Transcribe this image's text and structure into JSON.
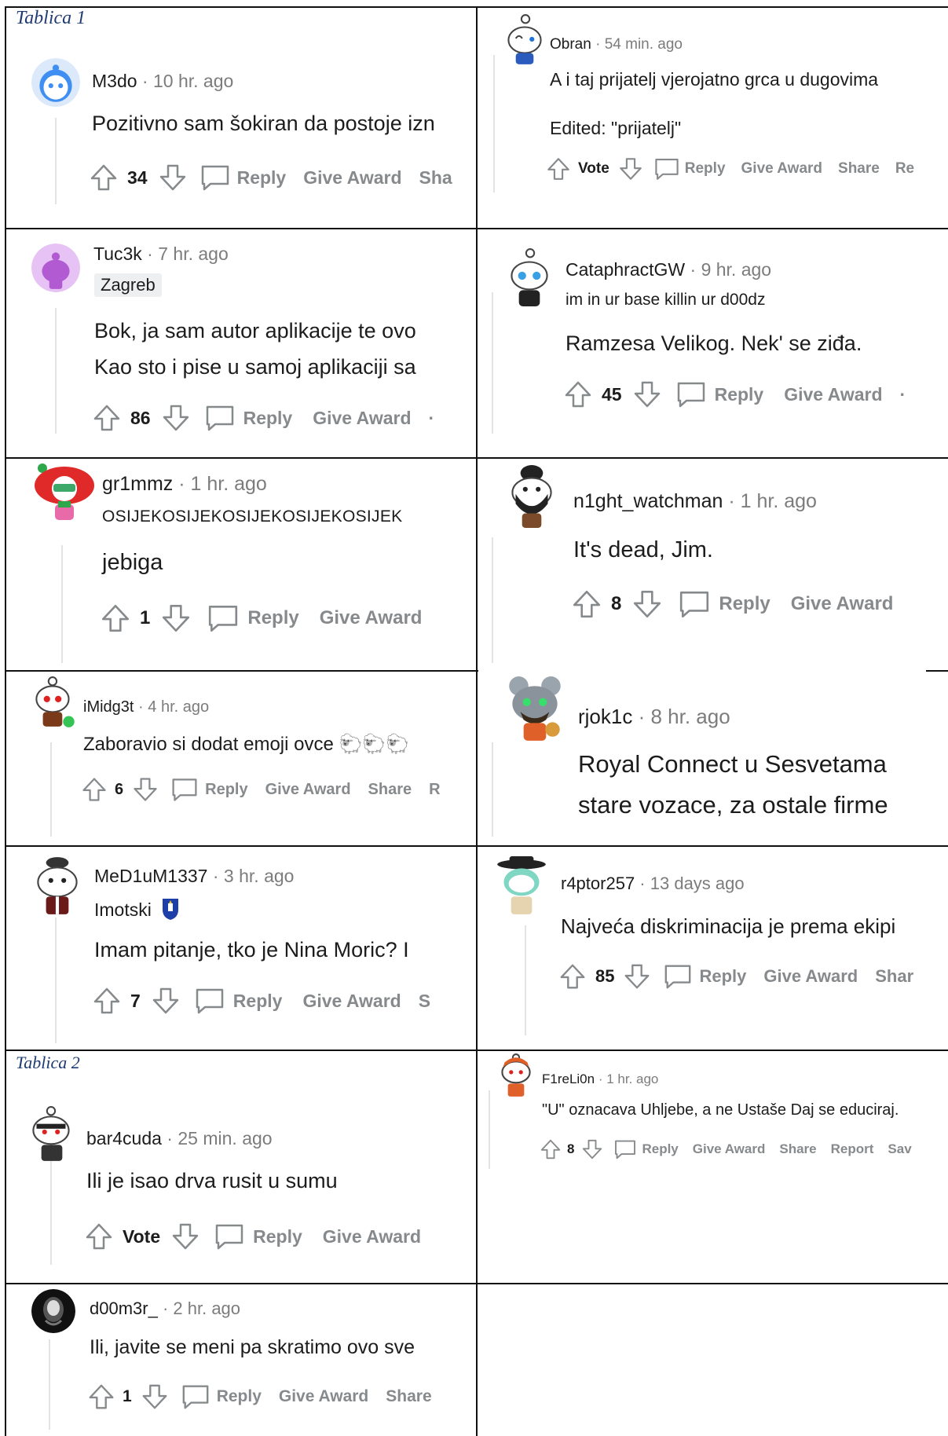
{
  "tables": [
    {
      "label": "Tablica 1"
    },
    {
      "label": "Tablica 2"
    }
  ],
  "comments": [
    {
      "id": "m3do",
      "user": "M3do",
      "time": "10 hr. ago",
      "lines": [
        "Pozitivno sam šokiran da postoje izn"
      ],
      "score": "34",
      "actions": [
        "Reply",
        "Give Award",
        "Sha"
      ]
    },
    {
      "id": "obran",
      "user": "Obran",
      "time": "54 min. ago",
      "lines": [
        "A i taj prijatelj vjerojatno grca u dugovima",
        "Edited: \"prijatelj\""
      ],
      "score": "Vote",
      "actions": [
        "Reply",
        "Give Award",
        "Share",
        "Re"
      ]
    },
    {
      "id": "tuc3k",
      "user": "Tuc3k",
      "time": "7 hr. ago",
      "flair": "Zagreb",
      "lines": [
        "Bok, ja sam autor aplikacije te ovo",
        "Kao sto i pise u samoj aplikaciji sa"
      ],
      "score": "86",
      "actions": [
        "Reply",
        "Give Award",
        "·"
      ]
    },
    {
      "id": "cataphract",
      "user": "CataphractGW",
      "time": "9 hr. ago",
      "flair": "im in ur base killin ur d00dz",
      "lines": [
        "Ramzesa Velikog. Nek' se ziđa."
      ],
      "score": "45",
      "actions": [
        "Reply",
        "Give Award",
        "·"
      ]
    },
    {
      "id": "gr1mmz",
      "user": "gr1mmz",
      "time": "1 hr. ago",
      "flair": "OSIJEKOSIJEKOSIJEKOSIJEKOSIJEK",
      "lines": [
        "jebiga"
      ],
      "score": "1",
      "actions": [
        "Reply",
        "Give Award"
      ]
    },
    {
      "id": "n1ght",
      "user": "n1ght_watchman",
      "time": "1 hr. ago",
      "lines": [
        "It's dead, Jim."
      ],
      "score": "8",
      "actions": [
        "Reply",
        "Give Award"
      ]
    },
    {
      "id": "imidg3t",
      "user": "iMidg3t",
      "time": "4 hr. ago",
      "lines": [
        "Zaboravio si dodat emoji ovce 🐑🐑🐑"
      ],
      "score": "6",
      "actions": [
        "Reply",
        "Give Award",
        "Share",
        "R"
      ]
    },
    {
      "id": "rjok1c",
      "user": "rjok1c",
      "time": "8 hr. ago",
      "lines": [
        "Royal Connect u Sesvetama",
        "stare vozace, za ostale firme"
      ],
      "actions": []
    },
    {
      "id": "med1um",
      "user": "MeD1uM1337",
      "time": "3 hr. ago",
      "flair": "Imotski",
      "lines": [
        "Imam pitanje, tko je Nina Moric? I"
      ],
      "score": "7",
      "actions": [
        "Reply",
        "Give Award",
        "S"
      ]
    },
    {
      "id": "r4ptor",
      "user": "r4ptor257",
      "time": "13 days ago",
      "lines": [
        "Najveća diskriminacija je prema ekipi"
      ],
      "score": "85",
      "actions": [
        "Reply",
        "Give Award",
        "Shar"
      ]
    },
    {
      "id": "bar4cuda",
      "user": "bar4cuda",
      "time": "25 min. ago",
      "lines": [
        "Ili je isao drva rusit u sumu"
      ],
      "score": "Vote",
      "actions": [
        "Reply",
        "Give Award"
      ]
    },
    {
      "id": "f1relion",
      "user": "F1reLi0n",
      "time": "1 hr. ago",
      "lines": [
        "\"U\" oznacava Uhljebe, a ne Ustaše Daj se educiraj."
      ],
      "score": "8",
      "actions": [
        "Reply",
        "Give Award",
        "Share",
        "Report",
        "Sav"
      ]
    },
    {
      "id": "d00m3r",
      "user": "d00m3r_",
      "time": "2 hr. ago",
      "lines": [
        "Ili, javite se meni pa skratimo ovo sve"
      ],
      "score": "1",
      "actions": [
        "Reply",
        "Give Award",
        "Share"
      ]
    }
  ],
  "icons": {
    "upvote": "arrow-up-icon",
    "downvote": "arrow-down-icon",
    "reply": "speech-bubble-icon"
  },
  "colors": {
    "meta": "#7c7c7c",
    "action": "#878a8c",
    "border": "#111111",
    "label": "#1f3b73"
  }
}
